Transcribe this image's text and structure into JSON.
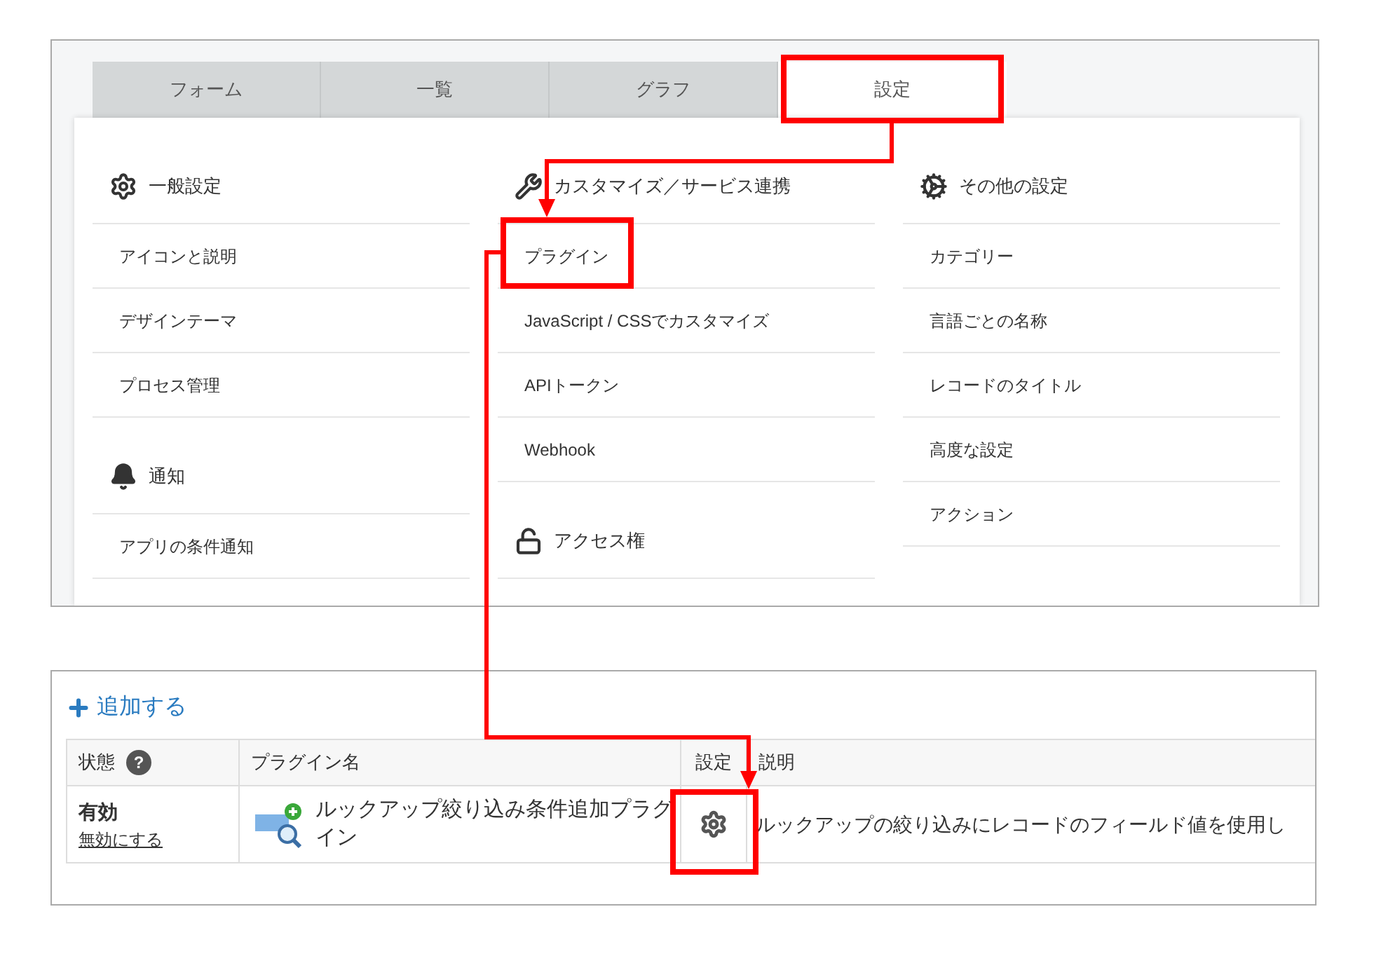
{
  "tabs": [
    {
      "label": "フォーム",
      "selected": false
    },
    {
      "label": "一覧",
      "selected": false
    },
    {
      "label": "グラフ",
      "selected": false
    },
    {
      "label": "設定",
      "selected": true
    }
  ],
  "settings_columns": [
    {
      "sections": [
        {
          "title": "一般設定",
          "items": [
            "アイコンと説明",
            "デザインテーマ",
            "プロセス管理"
          ]
        },
        {
          "title": "通知",
          "items": [
            "アプリの条件通知"
          ]
        }
      ]
    },
    {
      "sections": [
        {
          "title": "カスタマイズ／サービス連携",
          "items": [
            "プラグイン",
            "JavaScript / CSSでカスタマイズ",
            "APIトークン",
            "Webhook"
          ]
        },
        {
          "title": "アクセス権"
        }
      ]
    },
    {
      "sections": [
        {
          "title": "その他の設定",
          "items": [
            "カテゴリー",
            "言語ごとの名称",
            "レコードのタイトル",
            "高度な設定",
            "アクション"
          ]
        }
      ]
    }
  ],
  "add_link": "追加する",
  "plugin_table": {
    "columns": [
      "状態",
      "プラグイン名",
      "設定",
      "説明"
    ],
    "help_mark": "?",
    "rows": [
      {
        "status": "有効",
        "toggle_link": "無効にする",
        "name": "ルックアップ絞り込み条件追加プラグイン",
        "description": "ルックアップの絞り込みにレコードのフィールド値を使用し"
      }
    ]
  }
}
